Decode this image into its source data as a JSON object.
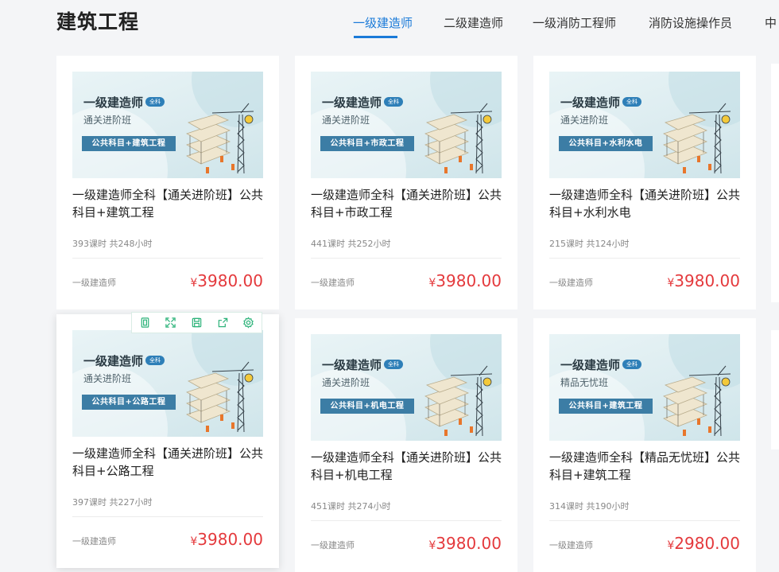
{
  "section": {
    "title": "建筑工程"
  },
  "tabs": [
    {
      "label": "一级建造师",
      "active": true
    },
    {
      "label": "二级建造师"
    },
    {
      "label": "一级消防工程师"
    },
    {
      "label": "消防设施操作员"
    },
    {
      "label": "中"
    }
  ],
  "colors": {
    "accent": "#1a7ad8",
    "price": "#e4393c",
    "thumb_bar": "#3c7da5",
    "toolbar_icon": "#2db37a"
  },
  "toolbar": {
    "icons": [
      "copy-icon",
      "expand-icon",
      "save-icon",
      "share-icon",
      "settings-icon"
    ]
  },
  "courses": [
    {
      "thumb_title": "一级建造师",
      "badge": "全科",
      "thumb_sub": "通关进阶班",
      "thumb_bar": "公共科目+建筑工程",
      "title": "一级建造师全科【通关进阶班】公共科目+建筑工程",
      "meta": "393课时 共248小时",
      "category": "一级建造师",
      "currency": "¥",
      "price": "3980.00"
    },
    {
      "thumb_title": "一级建造师",
      "badge": "全科",
      "thumb_sub": "通关进阶班",
      "thumb_bar": "公共科目+市政工程",
      "title": "一级建造师全科【通关进阶班】公共科目+市政工程",
      "meta": "441课时 共252小时",
      "category": "一级建造师",
      "currency": "¥",
      "price": "3980.00"
    },
    {
      "thumb_title": "一级建造师",
      "badge": "全科",
      "thumb_sub": "通关进阶班",
      "thumb_bar": "公共科目+水利水电",
      "title": "一级建造师全科【通关进阶班】公共科目+水利水电",
      "meta": "215课时 共124小时",
      "category": "一级建造师",
      "currency": "¥",
      "price": "3980.00"
    },
    {
      "thumb_title": "一级建造师",
      "badge": "全科",
      "thumb_sub": "通关进阶班",
      "thumb_bar": "公共科目+公路工程",
      "title": "一级建造师全科【通关进阶班】公共科目+公路工程",
      "meta": "397课时 共227小时",
      "category": "一级建造师",
      "currency": "¥",
      "price": "3980.00"
    },
    {
      "thumb_title": "一级建造师",
      "badge": "全科",
      "thumb_sub": "通关进阶班",
      "thumb_bar": "公共科目+机电工程",
      "title": "一级建造师全科【通关进阶班】公共科目+机电工程",
      "meta": "451课时 共274小时",
      "category": "一级建造师",
      "currency": "¥",
      "price": "3980.00"
    },
    {
      "thumb_title": "一级建造师",
      "badge": "全科",
      "thumb_sub": "精品无忧班",
      "thumb_bar": "公共科目+建筑工程",
      "title": "一级建造师全科【精品无忧班】公共科目+建筑工程",
      "meta": "314课时 共190小时",
      "category": "一级建造师",
      "currency": "¥",
      "price": "2980.00"
    }
  ]
}
